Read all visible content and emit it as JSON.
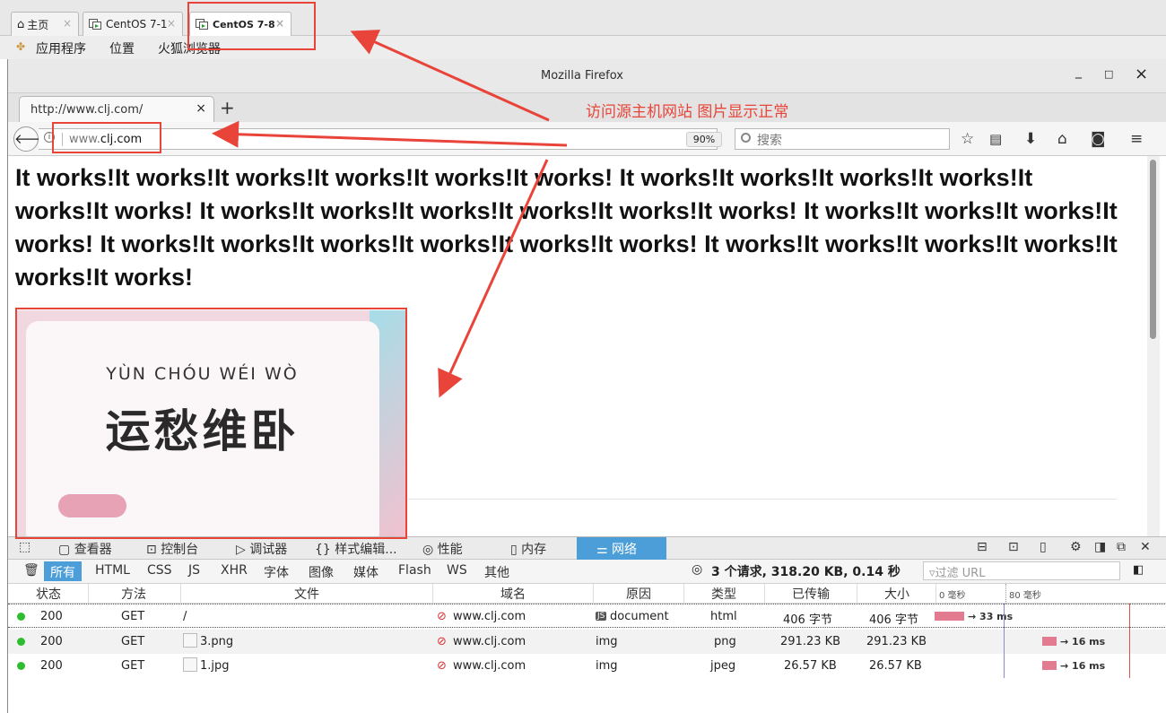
{
  "host": {
    "tabs": [
      {
        "label": "主页",
        "active": false
      },
      {
        "label": "CentOS 7-1",
        "active": false
      },
      {
        "label": "CentOS 7-8",
        "active": true
      }
    ],
    "menu": [
      "应用程序",
      "位置",
      "火狐浏览器"
    ]
  },
  "window": {
    "title": "Mozilla Firefox",
    "minimize": "_",
    "maximize": "□",
    "close": "×"
  },
  "browser": {
    "tab_label": "http://www.clj.com/",
    "tab_close": "×",
    "new_tab": "+",
    "url_prefix": "www.",
    "url_domain": "clj.com",
    "zoom": "90%",
    "search_placeholder": "搜索"
  },
  "annotation": {
    "text": "访问源主机网站 图片显示正常",
    "color": "#e8443a"
  },
  "page": {
    "text": "It works!It works!It works!It works!It works!It works! It works!It works!It works!It works!It works!It works! It works!It works!It works!It works!It works!It works! It works!It works!It works!It works! It works!It works!It works!It works!It works!It works! It works!It works!It works!It works!It works!It works!",
    "image_pinyin": "YÙN CHÓU WÉI WÒ",
    "image_chinese": "运愁维卧"
  },
  "devtools": {
    "tabs": [
      "查看器",
      "控制台",
      "调试器",
      "{} 样式编辑...",
      "性能",
      "内存",
      "网络"
    ],
    "selected_tab": "网络",
    "filters": [
      "所有",
      "HTML",
      "CSS",
      "JS",
      "XHR",
      "字体",
      "图像",
      "媒体",
      "Flash",
      "WS",
      "其他"
    ],
    "selected_filter": "所有",
    "summary": "3 个请求, 318.20 KB, 0.14 秒",
    "url_filter_placeholder": "过滤 URL",
    "columns": [
      "状态",
      "方法",
      "文件",
      "域名",
      "原因",
      "类型",
      "已传输",
      "大小"
    ],
    "timeline_ticks": [
      "0 毫秒",
      "80 毫秒"
    ],
    "requests": [
      {
        "status": "200",
        "method": "GET",
        "file": "/",
        "domain": "www.clj.com",
        "cause": "document",
        "type": "html",
        "transferred": "406 字节",
        "size": "406 字节",
        "timing": "→ 33 ms"
      },
      {
        "status": "200",
        "method": "GET",
        "file": "3.png",
        "domain": "www.clj.com",
        "cause": "img",
        "type": "png",
        "transferred": "291.23 KB",
        "size": "291.23 KB",
        "timing": "→ 16 ms"
      },
      {
        "status": "200",
        "method": "GET",
        "file": "1.jpg",
        "domain": "www.clj.com",
        "cause": "img",
        "type": "jpeg",
        "transferred": "26.57 KB",
        "size": "26.57 KB",
        "timing": "→ 16 ms"
      }
    ],
    "status_color": "#2ebd2e",
    "selected_color": "#4c9ed9"
  }
}
